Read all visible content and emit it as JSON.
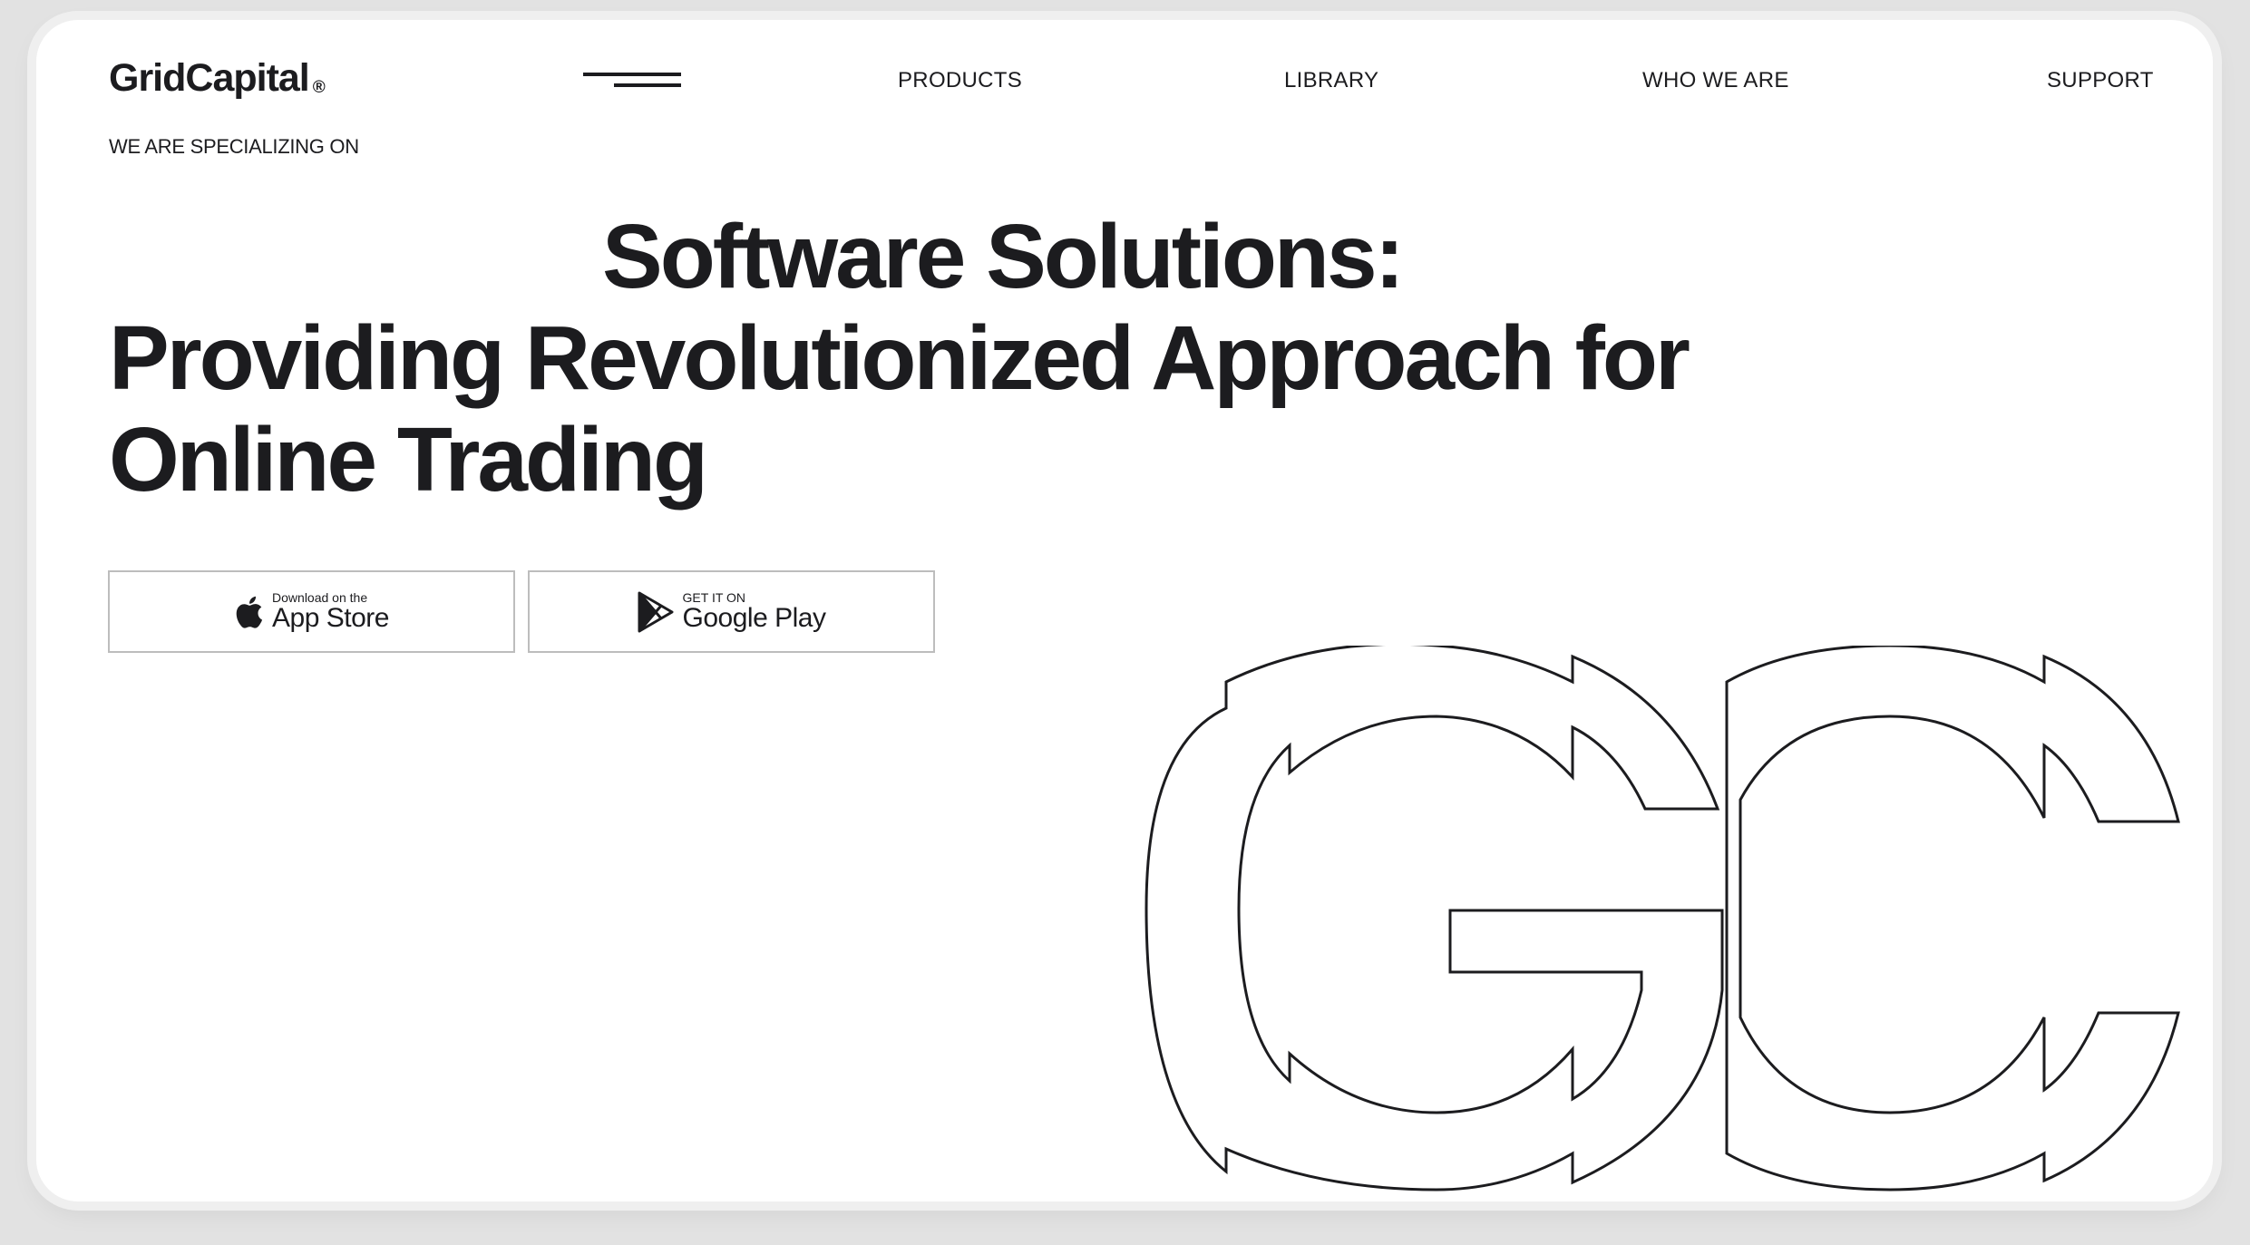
{
  "brand": {
    "name": "GridCapital",
    "registered_mark": "®"
  },
  "nav": {
    "items": [
      {
        "label": "PRODUCTS"
      },
      {
        "label": "LIBRARY"
      },
      {
        "label": "WHO WE ARE"
      },
      {
        "label": "SUPPORT"
      }
    ]
  },
  "hero": {
    "eyebrow": "WE ARE SPECIALIZING ON",
    "headline_line1": "Software Solutions:",
    "headline_line2": "Providing Revolutionized Approach for",
    "headline_line3": "Online Trading"
  },
  "store_buttons": {
    "app_store": {
      "small": "Download on the",
      "big": "App Store",
      "icon": "apple-icon"
    },
    "google_play": {
      "small": "GET IT ON",
      "big": "Google Play",
      "icon": "google-play-icon"
    }
  },
  "monogram": {
    "letters": "GC"
  },
  "colors": {
    "text": "#1c1c1f",
    "background": "#ffffff",
    "button_border": "#bdbdbd"
  }
}
